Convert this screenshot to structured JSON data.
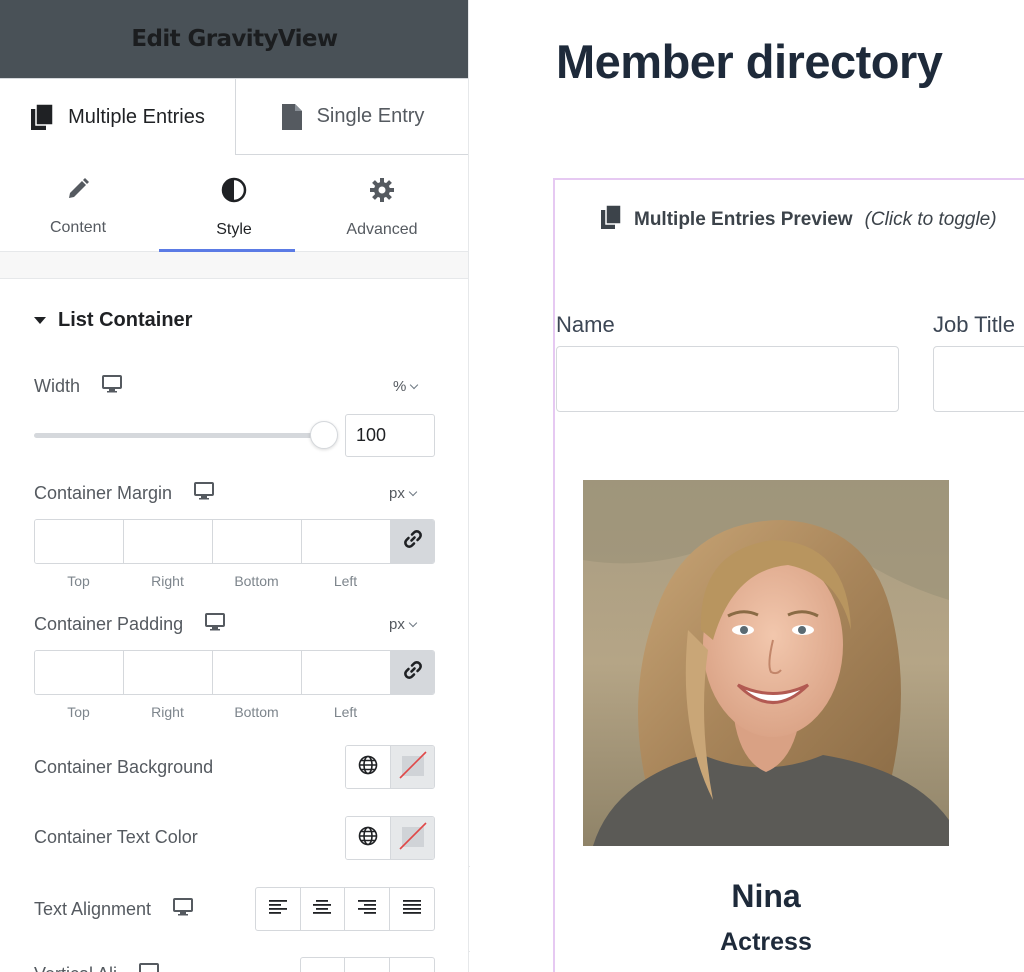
{
  "panel": {
    "title": "Edit GravityView",
    "entry_tabs": {
      "multiple": "Multiple Entries",
      "single": "Single Entry"
    },
    "section_tabs": {
      "content": "Content",
      "style": "Style",
      "advanced": "Advanced"
    },
    "group_title": "List Container",
    "width": {
      "label": "Width",
      "unit": "%",
      "value": "100",
      "slider_fraction": 1.0
    },
    "container_margin": {
      "label": "Container Margin",
      "unit": "px",
      "top": "Top",
      "right": "Right",
      "bottom": "Bottom",
      "left": "Left"
    },
    "container_padding": {
      "label": "Container Padding",
      "unit": "px",
      "top": "Top",
      "right": "Right",
      "bottom": "Bottom",
      "left": "Left"
    },
    "container_background": {
      "label": "Container Background"
    },
    "container_text_color": {
      "label": "Container Text Color"
    },
    "text_alignment": {
      "label": "Text Alignment"
    },
    "vertical_alignment": {
      "label": "Vertical Ali"
    }
  },
  "preview": {
    "page_title": "Member directory",
    "entries_preview_title": "Multiple Entries Preview",
    "entries_preview_hint": "(Click to toggle)",
    "fields": {
      "name_label": "Name",
      "job_label": "Job Title"
    },
    "member": {
      "name": "Nina",
      "job": "Actress"
    }
  },
  "colors": {
    "accent": "#5b7be5",
    "header_bg": "#495157",
    "frame": "#e6c9f2",
    "title": "#1e2a3a"
  },
  "icons": [
    "multiple-entries-icon",
    "single-entry-icon",
    "pencil-icon",
    "contrast-icon",
    "gear-icon",
    "monitor-icon",
    "chevron-down-icon",
    "link-icon",
    "globe-icon",
    "no-color-icon",
    "align-left-icon",
    "align-center-icon",
    "align-right-icon",
    "align-justify-icon",
    "chevron-left-icon"
  ]
}
